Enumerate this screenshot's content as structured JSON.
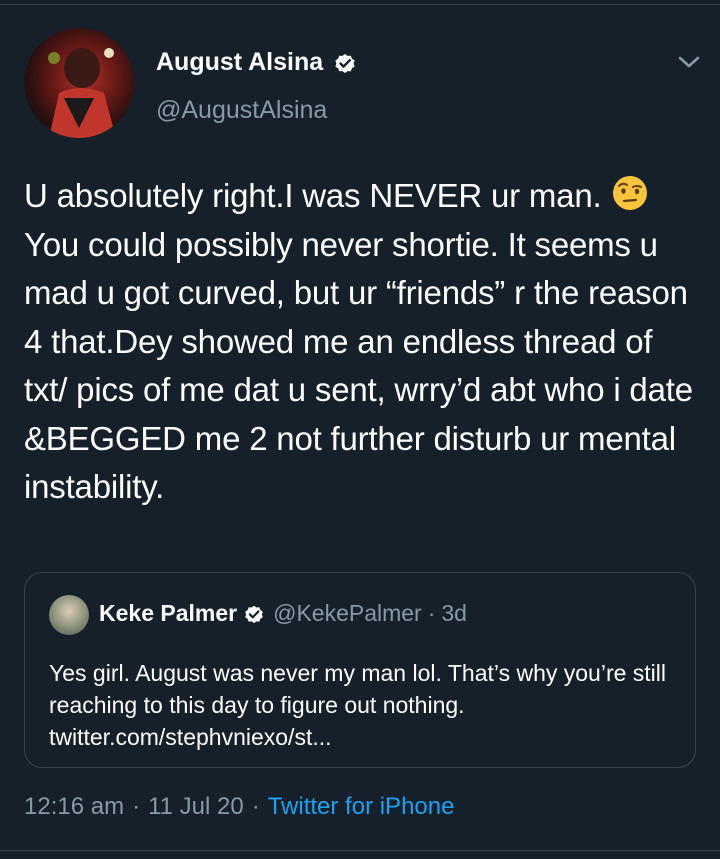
{
  "author": {
    "display_name": "August Alsina",
    "handle": "@AugustAlsina",
    "avatar_icon": "profile-photo",
    "verified_icon": "verified-badge-icon"
  },
  "tweet": {
    "text_before_emoji": "U absolutely right.I was NEVER ur man. ",
    "emoji_icon": "face-with-raised-eyebrow",
    "text_after_emoji": "You could possibly never shortie. It seems u mad u got curved, but ur “friends” r the reason 4 that.Dey showed me an endless thread of txt/ pics of me dat u sent, wrry’d abt who i date &BEGGED me 2 not further disturb ur mental instability."
  },
  "quoted_tweet": {
    "display_name": "Keke Palmer",
    "handle": "@KekePalmer",
    "separator": "·",
    "age": "3d",
    "text": "Yes girl. August was never my man lol. That’s why you’re still reaching to this day to figure out nothing. twitter.com/stephvniexo/st..."
  },
  "meta": {
    "time": "12:16 am",
    "separator1": "·",
    "date": "11 Jul 20",
    "separator2": "·",
    "source": "Twitter for iPhone"
  },
  "colors": {
    "background": "#15202b",
    "secondary_text": "#8899a6",
    "link": "#1da1f2",
    "border": "#38444d"
  }
}
